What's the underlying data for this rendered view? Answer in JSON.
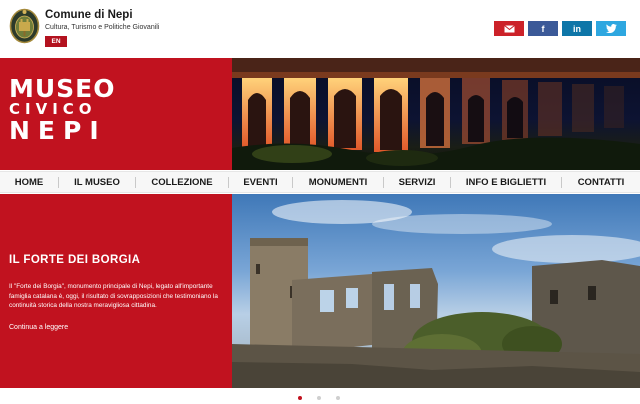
{
  "header": {
    "site_title": "Comune di Nepi",
    "site_subtitle": "Cultura, Turismo e Politiche Giovanili",
    "lang_label": "EN",
    "social": [
      "envelope-icon",
      "facebook-icon",
      "linkedin-icon",
      "twitter-icon"
    ]
  },
  "banner": {
    "logo_line1": "MUSEO",
    "logo_line2": "CIVICO",
    "logo_line3": "NEPI"
  },
  "nav": {
    "items": [
      "HOME",
      "IL MUSEO",
      "COLLEZIONE",
      "EVENTI",
      "MONUMENTI",
      "SERVIZI",
      "INFO E BIGLIETTI",
      "CONTATTI"
    ]
  },
  "hero": {
    "title": "IL FORTE DEI BORGIA",
    "text": "Il \"Forte dei Borgia\", monumento principale di Nepi, legato all'importante famiglia catalana è, oggi, il risultato di sovrapposizioni che testimoniano la continuità storica della nostra meravigliosa cittadina.",
    "link": "Continua a leggere"
  },
  "carousel": {
    "slide_count": 3,
    "active_index": 0
  },
  "colors": {
    "brand_red": "#c1121f",
    "badge_red": "#b3121f",
    "facebook": "#3b5998",
    "linkedin": "#0e76a8",
    "twitter": "#2ea7e0",
    "mail": "#cc2229"
  }
}
